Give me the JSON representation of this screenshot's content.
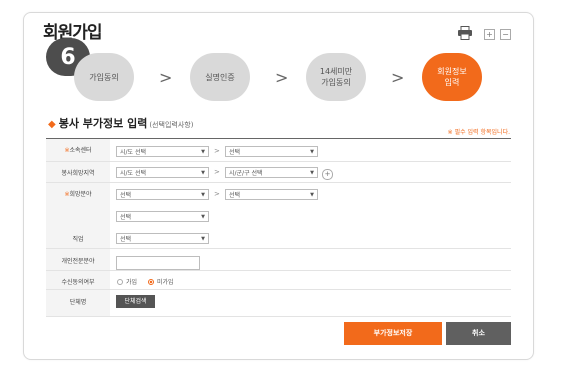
{
  "page": {
    "title": "회원가입",
    "step_badge": "6"
  },
  "header_controls": {
    "zoom_in": "+",
    "zoom_out": "−"
  },
  "steps": [
    {
      "label": "가입동의",
      "label2": ""
    },
    {
      "label": "실명인증",
      "label2": ""
    },
    {
      "label": "14세미만",
      "label2": "가입동의"
    },
    {
      "label": "회원정보",
      "label2": "입력"
    }
  ],
  "step_arrow": ">",
  "section": {
    "bullet": "◆",
    "title": "봉사 부가정보 입력",
    "subtitle": "(선택입력사항)",
    "required_note": "※ 필수 입력 항목입니다."
  },
  "form": {
    "required_mark": "※",
    "arrow": ">",
    "fields": {
      "center": {
        "label": "소속센터",
        "select1": "시/도 선택",
        "select2": "선택"
      },
      "region": {
        "label": "봉사희망지역",
        "select1": "시/도 선택",
        "select2": "시/군/구 선택",
        "add": "+"
      },
      "field": {
        "label": "희망분야",
        "select1": "선택",
        "select2": "선택",
        "select3": "선택"
      },
      "job": {
        "label": "직업",
        "select1": "선택"
      },
      "specialty": {
        "label": "개인전문분야",
        "value": ""
      },
      "consent": {
        "label": "수신동의여부",
        "opt_yes": "가입",
        "opt_no": "미가입",
        "selected": "미가입"
      },
      "group": {
        "label": "단체명",
        "button": "단체검색"
      }
    }
  },
  "buttons": {
    "save": "부가정보저장",
    "cancel": "취소"
  },
  "colors": {
    "accent": "#f26a1b",
    "dark_button": "#606060",
    "step_inactive": "#d9d9d9"
  },
  "icons": {
    "print": "printer-icon"
  }
}
